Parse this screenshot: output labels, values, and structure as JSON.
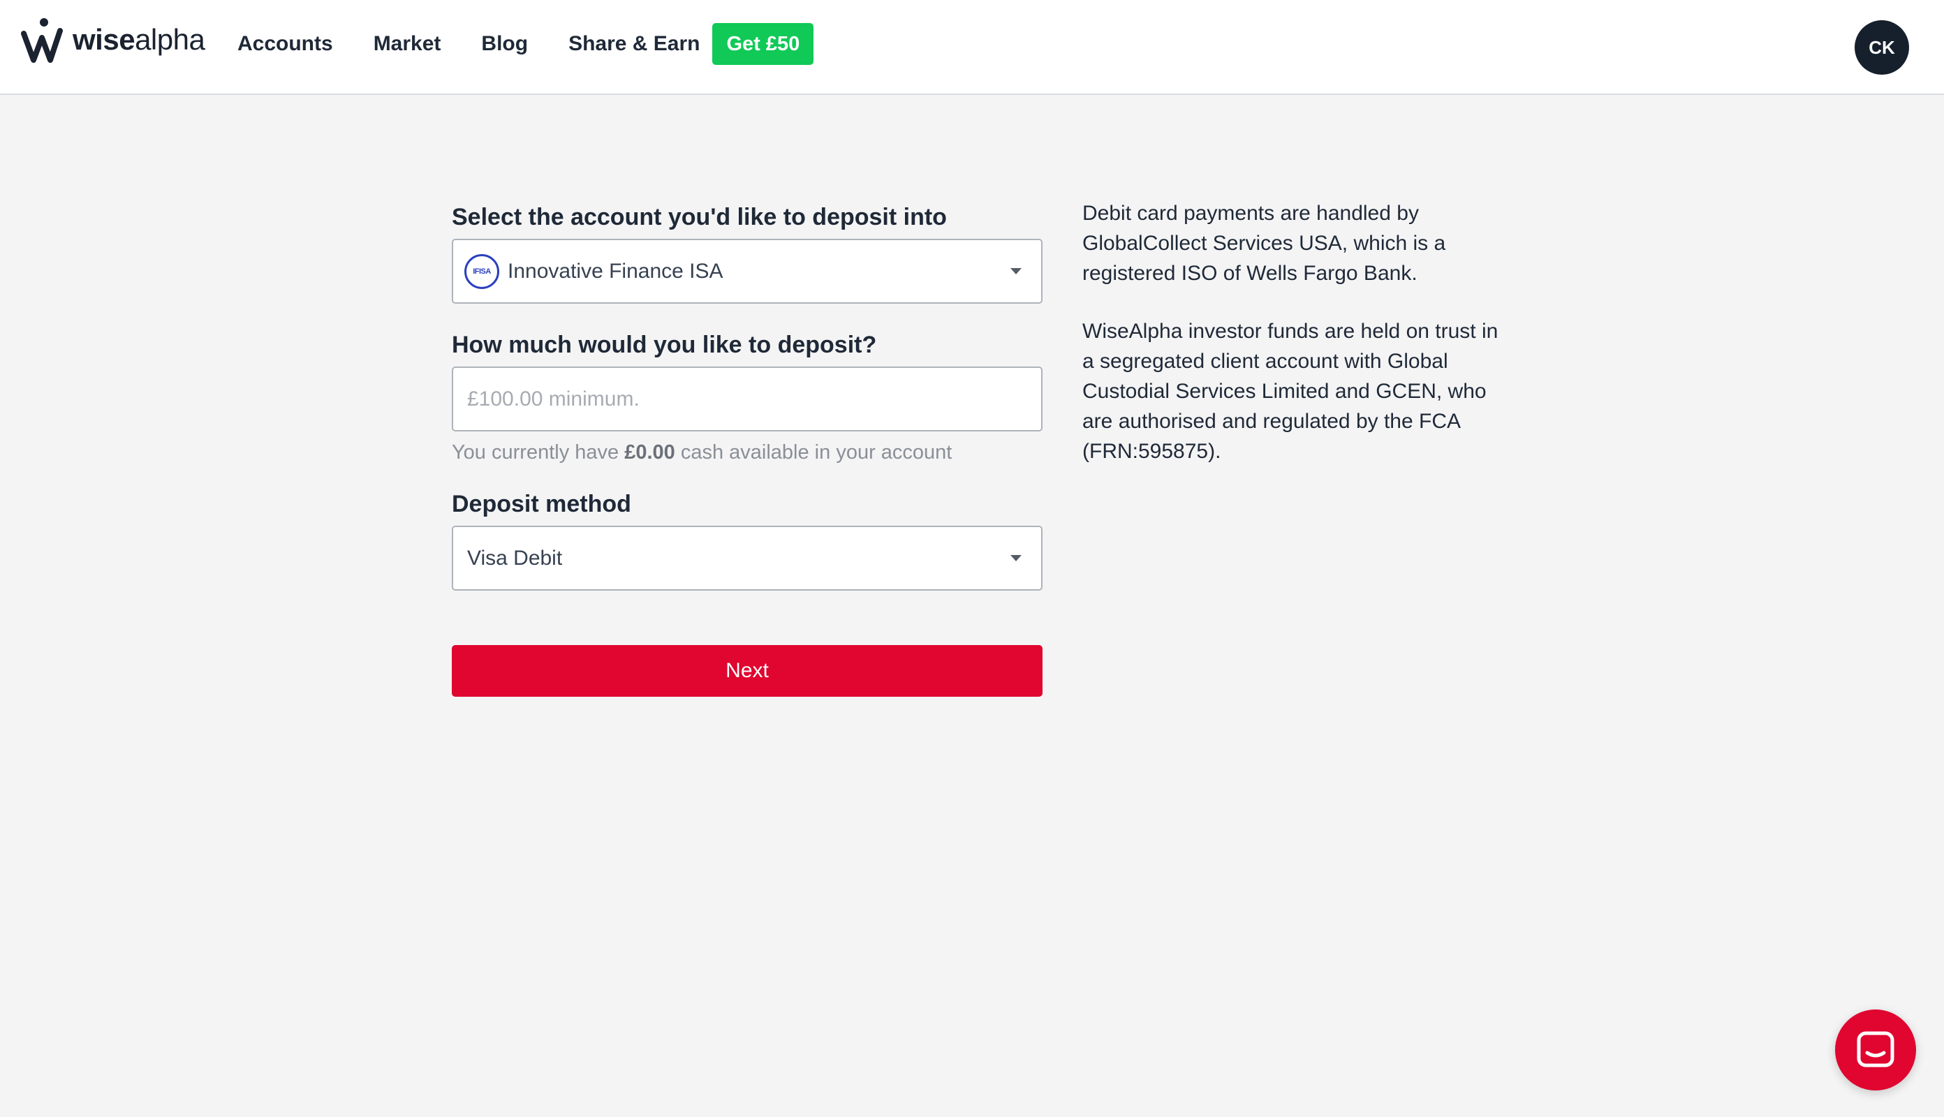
{
  "header": {
    "logo": {
      "icon": "wisealpha-logo-icon",
      "text_bold": "wise",
      "text_light": "alpha"
    },
    "nav": [
      "Accounts",
      "Market",
      "Blog",
      "Share & Earn"
    ],
    "promo_label": "Get £50",
    "avatar_initials": "CK"
  },
  "form": {
    "account_label": "Select the account you'd like to deposit into",
    "account_badge": "IFISA",
    "account_value": "Innovative Finance ISA",
    "amount_label": "How much would you like to deposit?",
    "amount_placeholder": "£100.00 minimum.",
    "amount_value": "",
    "helper_prefix": "You currently have",
    "helper_amount": "£0.00",
    "helper_suffix": "cash available in your account",
    "method_label": "Deposit method",
    "method_value": "Visa Debit",
    "next_label": "Next"
  },
  "info": {
    "p1": "Debit card payments are handled by GlobalCollect Services USA, which is a registered ISO of Wells Fargo Bank.",
    "p2": "WiseAlpha investor funds are held on trust in a segregated client account with Global Custodial Services Limited and GCEN, who are authorised and regulated by the FCA (FRN:595875)."
  },
  "chat": {
    "icon": "chat-bubble-icon"
  },
  "colors": {
    "accent": "#e0062f",
    "promo": "#10c957",
    "ifisa_badge": "#2a3fbf",
    "avatar_bg": "#16202d"
  }
}
